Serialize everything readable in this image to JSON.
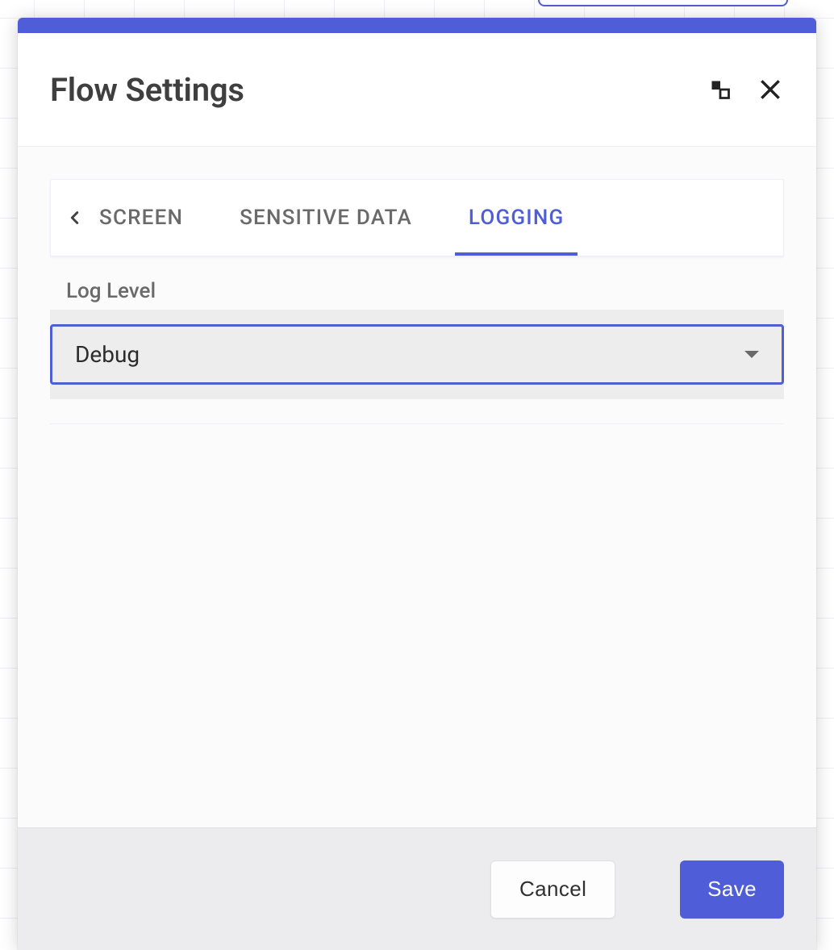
{
  "modal": {
    "title": "Flow Settings"
  },
  "tabs": {
    "screen": {
      "label": "SCREEN"
    },
    "sensitive": {
      "label": "SENSITIVE DATA"
    },
    "logging": {
      "label": "LOGGING"
    }
  },
  "logLevel": {
    "label": "Log Level",
    "value": "Debug"
  },
  "footer": {
    "cancel": "Cancel",
    "save": "Save"
  }
}
